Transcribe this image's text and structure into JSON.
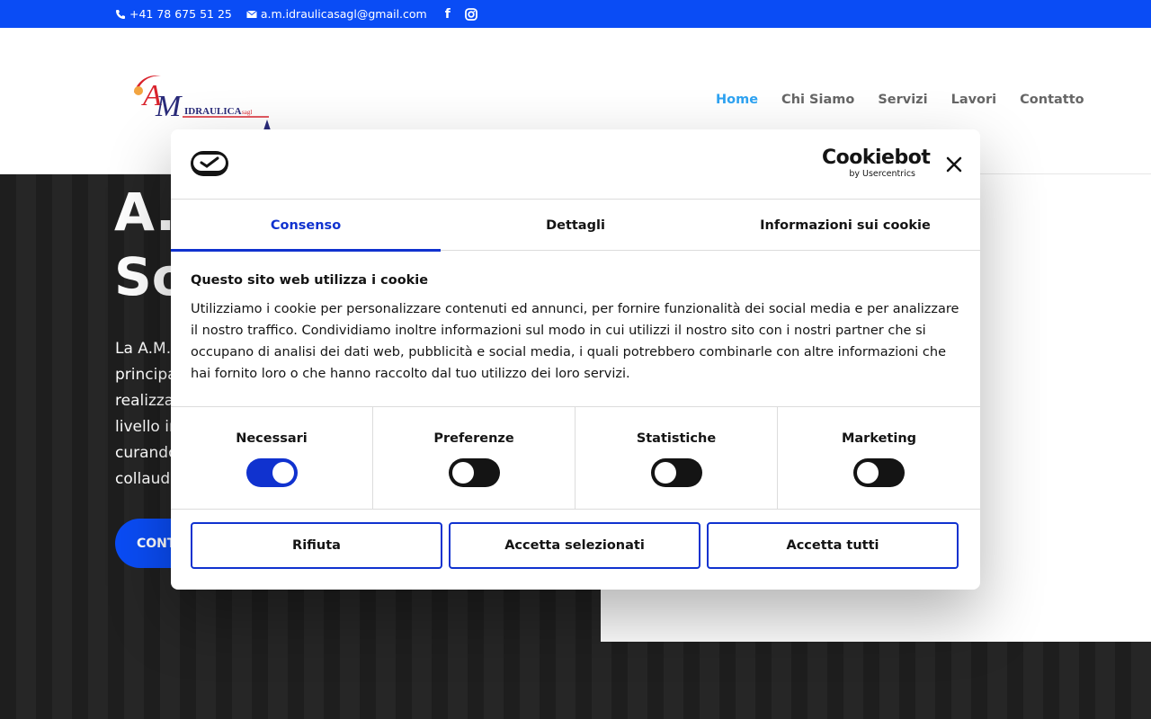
{
  "topbar": {
    "phone": "+41 78 675 51 25",
    "email": "a.m.idraulicasagl@gmail.com",
    "social": [
      {
        "icon": "facebook-icon",
        "glyph": "f"
      },
      {
        "icon": "instagram-icon",
        "glyph": ""
      }
    ]
  },
  "header": {
    "logo": {
      "main": "A M",
      "sub": "IDRAULICA",
      "suffix": "sagl"
    },
    "nav": [
      {
        "label": "Home",
        "active": true
      },
      {
        "label": "Chi Siamo",
        "active": false
      },
      {
        "label": "Servizi",
        "active": false
      },
      {
        "label": "Lavori",
        "active": false
      },
      {
        "label": "Contatto",
        "active": false
      }
    ]
  },
  "hero": {
    "title_line1": "A.",
    "title_line2": "So",
    "text_lines": [
      "La A.M.I",
      "principal",
      "realizzaz",
      "livello in",
      "curando",
      "collaudo"
    ],
    "button": "CONT"
  },
  "cookie": {
    "brand_main": "Cookiebot",
    "brand_sub": "by Usercentrics",
    "tabs": [
      {
        "label": "Consenso",
        "active": true
      },
      {
        "label": "Dettagli",
        "active": false
      },
      {
        "label": "Informazioni sui cookie",
        "active": false
      }
    ],
    "heading": "Questo sito web utilizza i cookie",
    "body": "Utilizziamo i cookie per personalizzare contenuti ed annunci, per fornire funzionalità dei social media e per analizzare il nostro traffico. Condividiamo inoltre informazioni sul modo in cui utilizzi il nostro sito con i nostri partner che si occupano di analisi dei dati web, pubblicità e social media, i quali potrebbero combinarle con altre informazioni che hai fornito loro o che hanno raccolto dal tuo utilizzo dei loro servizi.",
    "toggles": [
      {
        "label": "Necessari",
        "on": true
      },
      {
        "label": "Preferenze",
        "on": false
      },
      {
        "label": "Statistiche",
        "on": false
      },
      {
        "label": "Marketing",
        "on": false
      }
    ],
    "buttons": {
      "reject": "Rifiuta",
      "accept_selected": "Accetta selezionati",
      "accept_all": "Accetta tutti"
    },
    "colors": {
      "accent": "#1032cf",
      "topbar": "#0a4cf5",
      "nav_active": "#2ea3f2"
    }
  }
}
